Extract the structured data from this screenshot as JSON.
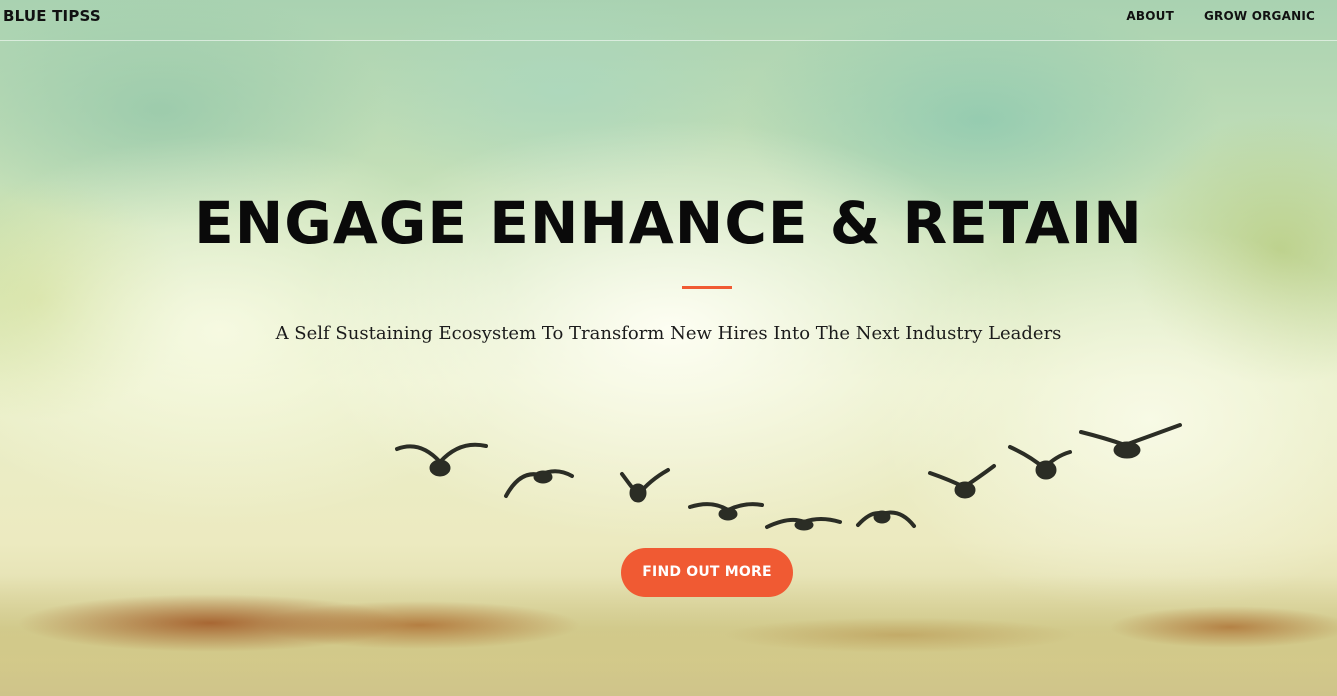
{
  "nav": {
    "brand": "BLUE TIPSS",
    "links": [
      {
        "label": "ABOUT"
      },
      {
        "label": "GROW ORGANIC"
      }
    ]
  },
  "hero": {
    "headline": "ENGAGE ENHANCE & RETAIN",
    "subtitle": "A Self Sustaining Ecosystem To Transform New Hires Into The Next Industry Leaders",
    "cta_label": "FIND OUT MORE",
    "accent_color": "#f05a33",
    "background": "green-cream sky with a flock of flying birds"
  }
}
